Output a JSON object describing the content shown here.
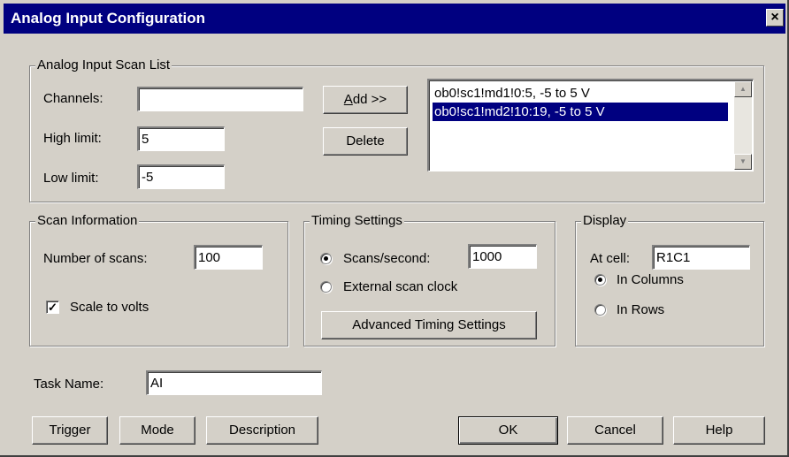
{
  "window": {
    "title": "Analog Input Configuration",
    "close_glyph": "×"
  },
  "scan_list": {
    "legend": "Analog Input Scan List",
    "channels_label": "Channels:",
    "channels_value": "",
    "high_label": "High limit:",
    "high_value": "5",
    "low_label": "Low limit:",
    "low_value": "-5",
    "add_label_key": "A",
    "add_label_rest": "dd >>",
    "delete_label": "Delete",
    "items": [
      "ob0!sc1!md1!0:5, -5 to 5 V",
      "ob0!sc1!md2!10:19, -5 to 5 V"
    ],
    "selected_index": 1
  },
  "scan_info": {
    "legend": "Scan Information",
    "num_scans_label": "Number of scans:",
    "num_scans_value": "100",
    "scale_label": "Scale to volts",
    "scale_checked": true
  },
  "timing": {
    "legend": "Timing Settings",
    "scans_per_second_label": "Scans/second:",
    "scans_per_second_value": "1000",
    "external_clock_label": "External scan clock",
    "selected": "scans_per_second",
    "advanced_label": "Advanced Timing Settings"
  },
  "display": {
    "legend": "Display",
    "at_cell_label": "At cell:",
    "at_cell_value": "R1C1",
    "in_columns_label": "In Columns",
    "in_rows_label": "In Rows",
    "selected": "in_columns"
  },
  "task": {
    "label": "Task Name:",
    "value": "AI"
  },
  "buttons": {
    "trigger": "Trigger",
    "mode": "Mode",
    "description": "Description",
    "ok": "OK",
    "cancel": "Cancel",
    "help": "Help"
  }
}
